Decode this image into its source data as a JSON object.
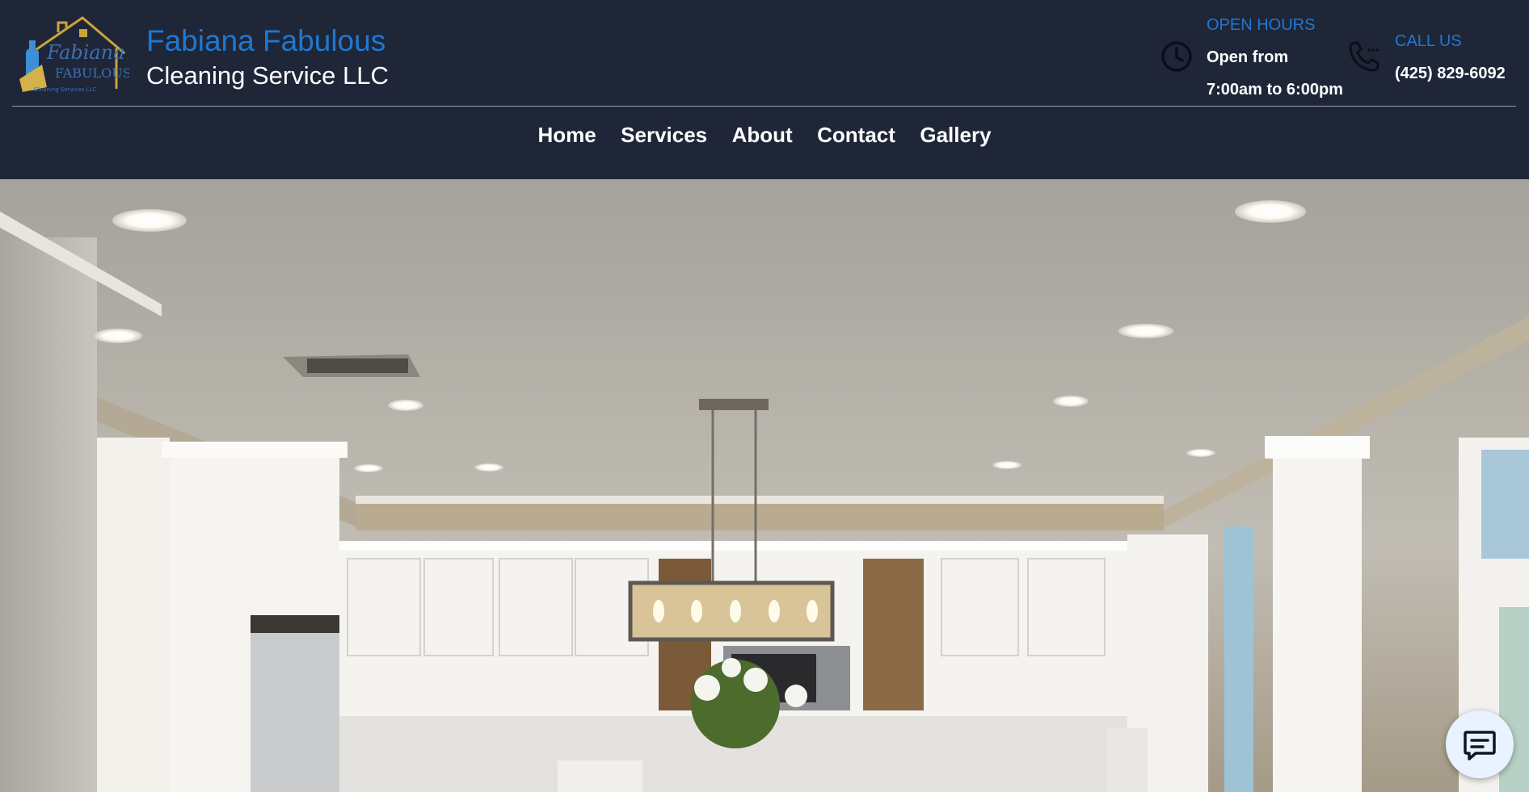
{
  "header": {
    "brand_line1": "Fabiana Fabulous",
    "brand_line2": "Cleaning Service LLC",
    "logo_text": "Fabiana Fabulous Cleaning Services LLC",
    "open_hours": {
      "title": "OPEN HOURS",
      "line1": "Open from",
      "line2": "7:00am to 6:00pm",
      "icon": "clock-icon"
    },
    "call_us": {
      "title": "CALL US",
      "number": "(425) 829-6092",
      "icon": "phone-icon"
    }
  },
  "nav": {
    "items": [
      "Home",
      "Services",
      "About",
      "Contact",
      "Gallery"
    ]
  },
  "chat": {
    "icon": "chat-icon"
  },
  "colors": {
    "header_bg": "#1f2638",
    "accent": "#1f78d1",
    "text": "#ffffff"
  }
}
